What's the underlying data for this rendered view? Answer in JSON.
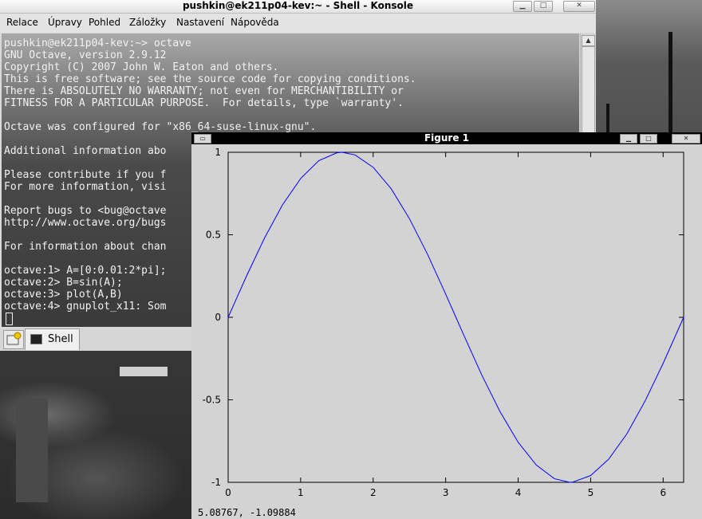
{
  "konsole": {
    "title": "pushkin@ek211p04-kev:~ - Shell - Konsole",
    "menu": [
      "Relace",
      "Úpravy",
      "Pohled",
      "Záložky",
      "Nastavení",
      "Nápověda"
    ],
    "lines": [
      "pushkin@ek211p04-kev:~> octave",
      "GNU Octave, version 2.9.12",
      "Copyright (C) 2007 John W. Eaton and others.",
      "This is free software; see the source code for copying conditions.",
      "There is ABSOLUTELY NO WARRANTY; not even for MERCHANTIBILITY or",
      "FITNESS FOR A PARTICULAR PURPOSE.  For details, type `warranty'.",
      "",
      "Octave was configured for \"x86_64-suse-linux-gnu\".",
      "",
      "Additional information abo",
      "",
      "Please contribute if you f",
      "For more information, visi",
      "",
      "Report bugs to <bug@octave",
      "http://www.octave.org/bugs",
      "",
      "For information about chan",
      "",
      "octave:1> A=[0:0.01:2*pi];",
      "octave:2> B=sin(A);",
      "octave:3> plot(A,B)",
      "octave:4> gnuplot_x11: Som"
    ],
    "tab_label": "Shell",
    "icons": {
      "new_tab": "new-tab-icon",
      "tab": "terminal-icon"
    }
  },
  "figure": {
    "title": "Figure 1",
    "coord_readout": "5.08767, -1.09884",
    "line_color": "#0000ff"
  },
  "chart_data": {
    "type": "line",
    "title": "",
    "xlabel": "",
    "ylabel": "",
    "xlim": [
      0,
      6.283
    ],
    "ylim": [
      -1,
      1
    ],
    "x_ticks": [
      "0",
      "1",
      "2",
      "3",
      "4",
      "5",
      "6"
    ],
    "y_ticks": [
      "1",
      "0.5",
      "0",
      "-0.5",
      "-1"
    ],
    "series": [
      {
        "x": [
          0,
          0.25,
          0.5,
          0.75,
          1,
          1.25,
          1.5,
          1.5708,
          1.75,
          2,
          2.25,
          2.5,
          2.75,
          3,
          3.1416,
          3.25,
          3.5,
          3.75,
          4,
          4.25,
          4.5,
          4.7124,
          4.75,
          5,
          5.25,
          5.5,
          5.75,
          6,
          6.283
        ],
        "y": [
          0,
          0.247,
          0.479,
          0.682,
          0.841,
          0.949,
          0.997,
          1,
          0.984,
          0.909,
          0.778,
          0.598,
          0.382,
          0.141,
          0,
          -0.108,
          -0.351,
          -0.572,
          -0.757,
          -0.895,
          -0.978,
          -1,
          -0.999,
          -0.959,
          -0.859,
          -0.706,
          -0.508,
          -0.279,
          0
        ]
      }
    ],
    "grid": false
  }
}
